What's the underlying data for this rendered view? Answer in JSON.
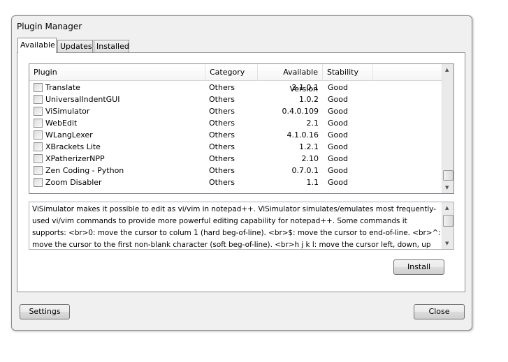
{
  "window": {
    "title": "Plugin Manager"
  },
  "tabs": [
    {
      "label": "Available"
    },
    {
      "label": "Updates"
    },
    {
      "label": "Installed"
    }
  ],
  "list": {
    "headers": {
      "plugin": "Plugin",
      "category": "Category",
      "version": "Available Version",
      "stability": "Stability"
    },
    "rows": [
      {
        "plugin": "Translate",
        "category": "Others",
        "version": "2.1.0.1",
        "stability": "Good"
      },
      {
        "plugin": "UniversalIndentGUI",
        "category": "Others",
        "version": "1.0.2",
        "stability": "Good"
      },
      {
        "plugin": "ViSimulator",
        "category": "Others",
        "version": "0.4.0.109",
        "stability": "Good"
      },
      {
        "plugin": "WebEdit",
        "category": "Others",
        "version": "2.1",
        "stability": "Good"
      },
      {
        "plugin": "WLangLexer",
        "category": "Others",
        "version": "4.1.0.16",
        "stability": "Good"
      },
      {
        "plugin": "XBrackets Lite",
        "category": "Others",
        "version": "1.2.1",
        "stability": "Good"
      },
      {
        "plugin": "XPatherizerNPP",
        "category": "Others",
        "version": "2.10",
        "stability": "Good"
      },
      {
        "plugin": "Zen Coding - Python",
        "category": "Others",
        "version": "0.7.0.1",
        "stability": "Good"
      },
      {
        "plugin": "Zoom Disabler",
        "category": "Others",
        "version": "1.1",
        "stability": "Good"
      }
    ]
  },
  "description": "ViSimulator makes it possible to edit as vi/vim in notepad++. ViSimulator simulates/emulates most frequently-used vi/vim commands to provide more powerful editing capability for notepad++. Some commands it supports: <br>0: move the cursor to colum 1 (hard beg-of-line). <br>$: move the cursor to end-of-line. <br>^: move the cursor to the first non-blank character (soft beg-of-line). <br>h j k l: move the cursor left, down, up and right [count] colum/line. <br>w: move the cursor to the beginning of next [count] word. <br>b: move the cursor to the beginning of previous [count]",
  "buttons": {
    "install": "Install",
    "settings": "Settings",
    "close": "Close"
  }
}
